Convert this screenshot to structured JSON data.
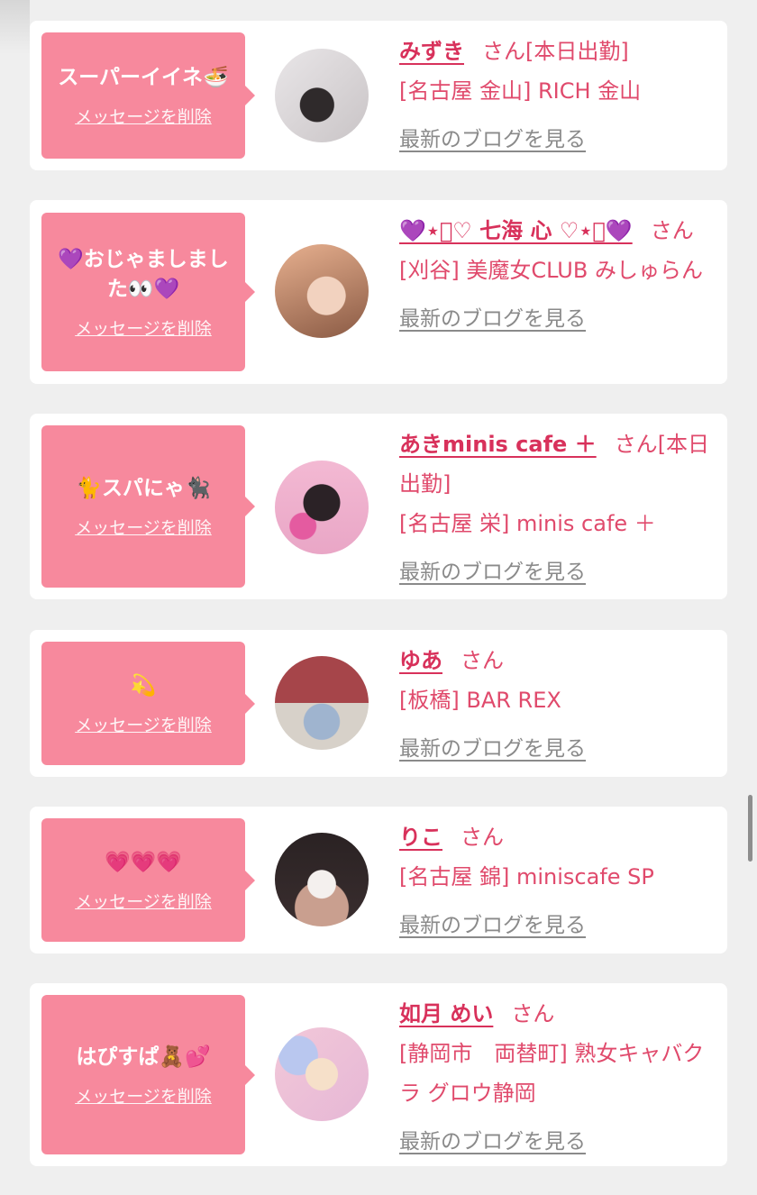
{
  "cards": [
    {
      "message": "スーパーイイネ🍜",
      "delete_label": "メッセージを削除",
      "name": "みずき",
      "honorific": "さん",
      "status": "[本日出勤]",
      "shop": "[名古屋 金山] RICH 金山",
      "blog_label": "最新のブログを見る",
      "avatar_colors": [
        "#c9c4c6",
        "#2f2a2b",
        "#e9e6e8"
      ]
    },
    {
      "message": "💜おじゃましました👀💜",
      "delete_label": "メッセージを削除",
      "name": "💜⋆͛♡ 七海 心 ♡⋆͛💜",
      "honorific": "さん",
      "status": "",
      "shop": "[刈谷] 美魔女CLUB みしゅらん",
      "blog_label": "最新のブログを見る",
      "avatar_colors": [
        "#e7b08f",
        "#8a5a44",
        "#f2d2bf"
      ]
    },
    {
      "message": "🐈スパにゃ🐈‍⬛",
      "delete_label": "メッセージを削除",
      "name": "あきminis cafe ＋",
      "honorific": "さん",
      "status": "[本日出勤]",
      "shop": "[名古屋 栄] minis cafe ＋",
      "blog_label": "最新のブログを見る",
      "avatar_colors": [
        "#f3b9d3",
        "#2b2226",
        "#e45ba0"
      ]
    },
    {
      "message": "💫",
      "delete_label": "メッセージを削除",
      "name": "ゆあ",
      "honorific": "さん",
      "status": "",
      "shop": "[板橋] BAR REX",
      "blog_label": "最新のブログを見る",
      "avatar_colors": [
        "#a6454a",
        "#d7d1c9",
        "#9fb4cf"
      ]
    },
    {
      "message": "💗💗💗",
      "delete_label": "メッセージを削除",
      "name": "りこ",
      "honorific": "さん",
      "status": "",
      "shop": "[名古屋 錦] miniscafe SP",
      "blog_label": "最新のブログを見る",
      "avatar_colors": [
        "#2a2223",
        "#f4f0ee",
        "#c99f8f"
      ]
    },
    {
      "message": "はぴすぱ🧸💕",
      "delete_label": "メッセージを削除",
      "name": "如月 めい",
      "honorific": "さん",
      "status": "",
      "shop": "[静岡市　両替町] 熟女キャバクラ グロウ静岡",
      "blog_label": "最新のブログを見る",
      "avatar_colors": [
        "#f2c8d8",
        "#b9c7ef",
        "#f6e0c9"
      ]
    }
  ]
}
